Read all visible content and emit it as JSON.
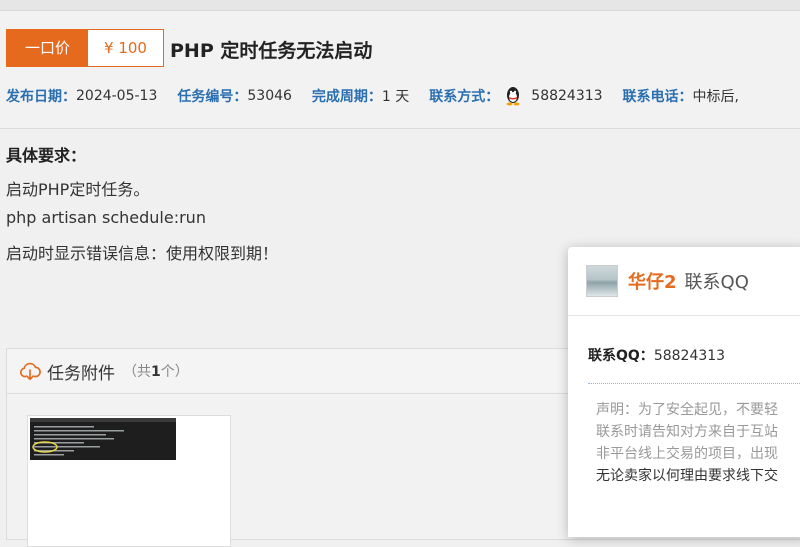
{
  "price": {
    "type": "一口价",
    "amount": "¥ 100"
  },
  "task": {
    "title": "PHP 定时任务无法启动"
  },
  "meta": {
    "publish_label": "发布日期：",
    "publish_value": "2024-05-13",
    "id_label": "任务编号：",
    "id_value": "53046",
    "period_label": "完成周期：",
    "period_value": "1 天",
    "contact_label": "联系方式：",
    "contact_icon": "qq-penguin-icon",
    "contact_value": "58824313",
    "phone_label": "联系电话：",
    "phone_value": "中标后,"
  },
  "requirements": {
    "title": "具体要求：",
    "lines": [
      "启动PHP定时任务。",
      "php artisan schedule:run",
      "启动时显示错误信息：使用权限到期！"
    ]
  },
  "attachments": {
    "icon": "cloud-download-icon",
    "title": "任务附件",
    "count_prefix": "（共",
    "count": "1",
    "count_suffix": "个）"
  },
  "popup": {
    "name": "华仔2",
    "subtitle": "联系QQ",
    "qq_label": "联系QQ：",
    "qq_value": "58824313",
    "notice_lines": [
      "声明：为了安全起见，不要轻",
      "联系时请告知对方来自于互站",
      "非平台线上交易的项目，出现",
      "无论卖家以何理由要求线下交"
    ]
  },
  "colors": {
    "accent": "#e66a1d",
    "label_blue": "#2a6fb0"
  }
}
